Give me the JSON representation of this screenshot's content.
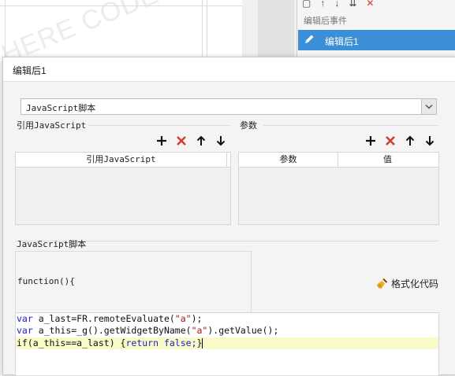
{
  "background": {
    "watermark": "HERE CODE",
    "event_panel": {
      "title": "编辑后事件",
      "selected_item": "编辑后1"
    }
  },
  "dialog": {
    "title": "编辑后1",
    "script_type": "JavaScript脚本",
    "ref_js": {
      "label": "引用JavaScript",
      "header": "引用JavaScript"
    },
    "params": {
      "label": "参数",
      "col1": "参数",
      "col2": "值"
    },
    "script_section_label": "JavaScript脚本",
    "function_header": "function(){",
    "format_label": "格式化代码",
    "code_lines": [
      [
        "var",
        " a_last=FR.remoteEvaluate(",
        "\"a\"",
        ");"
      ],
      [
        "var",
        " a_this=_g().getWidgetByName(",
        "\"a\"",
        ").getValue();"
      ],
      [
        "if(a_this==a_last) {",
        "return false;",
        "}"
      ]
    ]
  },
  "colors": {
    "accent": "#3a8fd6",
    "delete": "#d13b2c",
    "keyword": "#1d1dcc",
    "string": "#a31515",
    "line_highlight": "#fafac8"
  },
  "icons": [
    "add-icon",
    "delete-icon",
    "move-up-icon",
    "move-down-icon",
    "dropdown-chevron-icon",
    "broom-icon",
    "pencil-icon"
  ]
}
